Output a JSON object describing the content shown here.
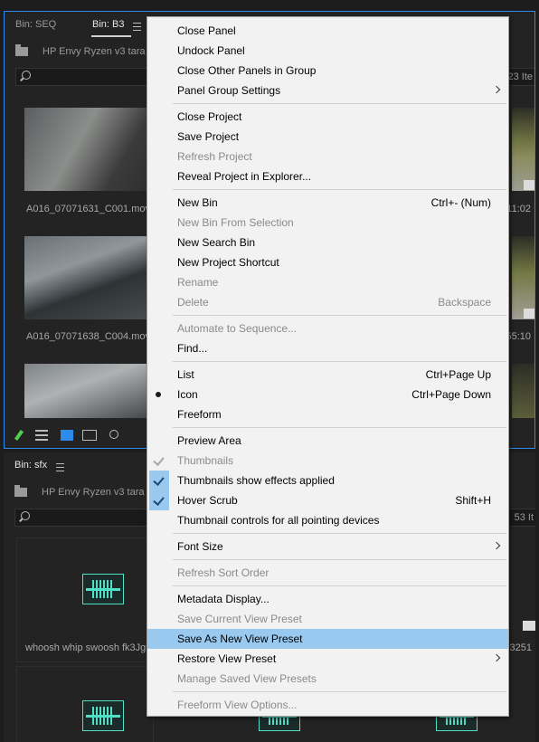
{
  "top_panel": {
    "tab_inactive": "Bin: SEQ",
    "tab_active": "Bin: B3",
    "path": "HP Envy Ryzen v3 tara",
    "item_count": "23 Ite",
    "items": [
      {
        "caption": "A016_07071631_C001.mov",
        "right_caption": "11:02"
      },
      {
        "caption": "A016_07071638_C004.mov",
        "right_caption": "55:10"
      }
    ]
  },
  "bottom_panel": {
    "tab": "Bin: sfx",
    "path": "HP Envy Ryzen v3 tara",
    "item_count": "53 It",
    "items": [
      {
        "caption": "whoosh whip swoosh fk3Jg",
        "right_caption": "03251"
      }
    ]
  },
  "context_menu": {
    "groups": [
      [
        {
          "label": "Close Panel"
        },
        {
          "label": "Undock Panel"
        },
        {
          "label": "Close Other Panels in Group"
        },
        {
          "label": "Panel Group Settings",
          "submenu": true
        }
      ],
      [
        {
          "label": "Close Project"
        },
        {
          "label": "Save Project"
        },
        {
          "label": "Refresh Project",
          "disabled": true
        },
        {
          "label": "Reveal Project in Explorer..."
        }
      ],
      [
        {
          "label": "New Bin",
          "shortcut": "Ctrl+- (Num)"
        },
        {
          "label": "New Bin From Selection",
          "disabled": true
        },
        {
          "label": "New Search Bin"
        },
        {
          "label": "New Project Shortcut"
        },
        {
          "label": "Rename",
          "disabled": true
        },
        {
          "label": "Delete",
          "shortcut": "Backspace",
          "disabled": true
        }
      ],
      [
        {
          "label": "Automate to Sequence...",
          "disabled": true
        },
        {
          "label": "Find..."
        }
      ],
      [
        {
          "label": "List",
          "shortcut": "Ctrl+Page Up"
        },
        {
          "label": "Icon",
          "shortcut": "Ctrl+Page Down",
          "radio": true
        },
        {
          "label": "Freeform"
        }
      ],
      [
        {
          "label": "Preview Area"
        },
        {
          "label": "Thumbnails",
          "disabled": true,
          "checked_dim": true
        },
        {
          "label": "Thumbnails show effects applied",
          "checked": true
        },
        {
          "label": "Hover Scrub",
          "shortcut": "Shift+H",
          "checked": true
        },
        {
          "label": "Thumbnail controls for all pointing devices"
        }
      ],
      [
        {
          "label": "Font Size",
          "submenu": true
        }
      ],
      [
        {
          "label": "Refresh Sort Order",
          "disabled": true
        }
      ],
      [
        {
          "label": "Metadata Display..."
        },
        {
          "label": "Save Current View Preset",
          "disabled": true
        },
        {
          "label": "Save As New View Preset",
          "highlighted": true
        },
        {
          "label": "Restore View Preset",
          "submenu": true
        },
        {
          "label": "Manage Saved View Presets",
          "disabled": true
        }
      ],
      [
        {
          "label": "Freeform View Options...",
          "disabled": true
        }
      ]
    ]
  }
}
